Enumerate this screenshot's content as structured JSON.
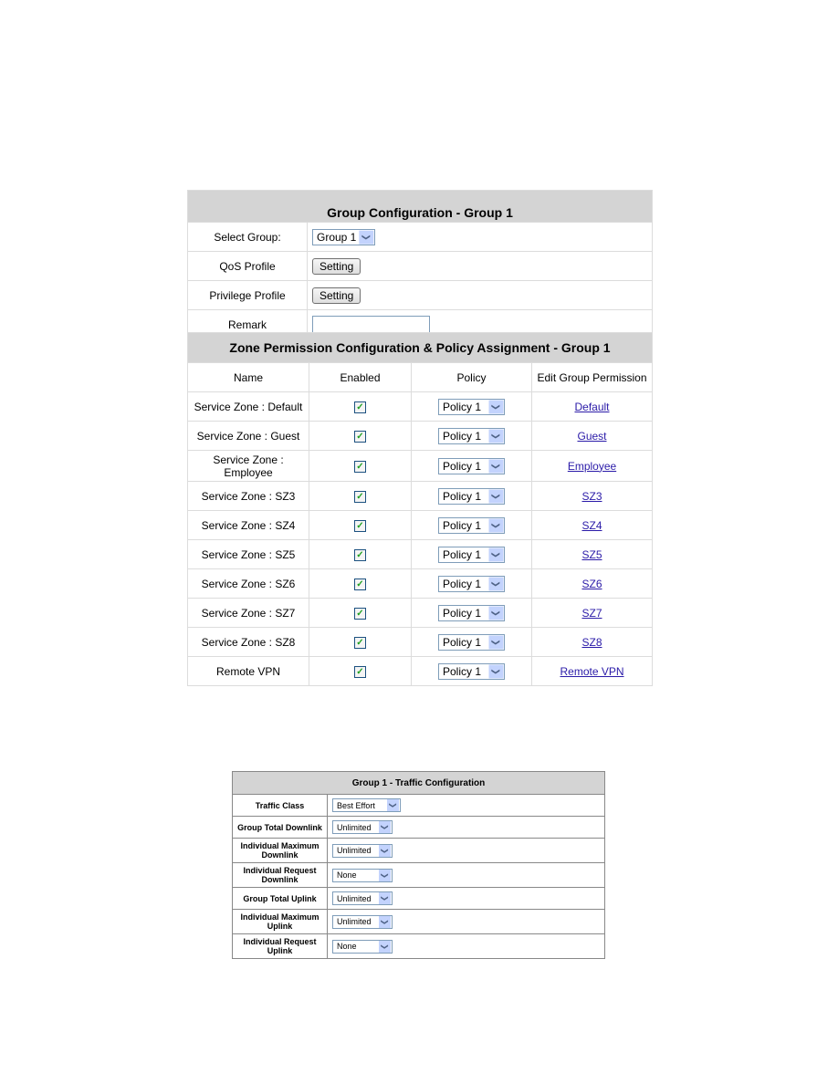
{
  "group_config": {
    "title": "Group Configuration - Group 1",
    "select_group_label": "Select Group:",
    "select_group_value": "Group 1",
    "qos_profile_label": "QoS Profile",
    "qos_button": "Setting",
    "privilege_profile_label": "Privilege Profile",
    "privilege_button": "Setting",
    "remark_label": "Remark",
    "remark_value": ""
  },
  "zone_config": {
    "title": "Zone Permission Configuration & Policy Assignment - Group 1",
    "columns": [
      "Name",
      "Enabled",
      "Policy",
      "Edit Group Permission"
    ],
    "rows": [
      {
        "name": "Service Zone : Default",
        "enabled": true,
        "policy": "Policy 1",
        "link": "Default"
      },
      {
        "name": "Service Zone : Guest",
        "enabled": true,
        "policy": "Policy 1",
        "link": "Guest"
      },
      {
        "name": "Service Zone : Employee",
        "enabled": true,
        "policy": "Policy 1",
        "link": "Employee"
      },
      {
        "name": "Service Zone : SZ3",
        "enabled": true,
        "policy": "Policy 1",
        "link": "SZ3"
      },
      {
        "name": "Service Zone : SZ4",
        "enabled": true,
        "policy": "Policy 1",
        "link": "SZ4"
      },
      {
        "name": "Service Zone : SZ5",
        "enabled": true,
        "policy": "Policy 1",
        "link": "SZ5"
      },
      {
        "name": "Service Zone : SZ6",
        "enabled": true,
        "policy": "Policy 1",
        "link": "SZ6"
      },
      {
        "name": "Service Zone : SZ7",
        "enabled": true,
        "policy": "Policy 1",
        "link": "SZ7"
      },
      {
        "name": "Service Zone : SZ8",
        "enabled": true,
        "policy": "Policy 1",
        "link": "SZ8"
      },
      {
        "name": "Remote VPN",
        "enabled": true,
        "policy": "Policy 1",
        "link": "Remote VPN"
      }
    ]
  },
  "traffic_config": {
    "title": "Group 1 - Traffic Configuration",
    "rows": [
      {
        "label": "Traffic Class",
        "value": "Best Effort"
      },
      {
        "label": "Group Total Downlink",
        "value": "Unlimited"
      },
      {
        "label": "Individual Maximum Downlink",
        "value": "Unlimited"
      },
      {
        "label": "Individual Request Downlink",
        "value": "None"
      },
      {
        "label": "Group Total Uplink",
        "value": "Unlimited"
      },
      {
        "label": "Individual Maximum Uplink",
        "value": "Unlimited"
      },
      {
        "label": "Individual Request Uplink",
        "value": "None"
      }
    ]
  },
  "icons": {
    "dropdown": "chevron-down-icon",
    "checkbox": "checkmark-icon"
  }
}
